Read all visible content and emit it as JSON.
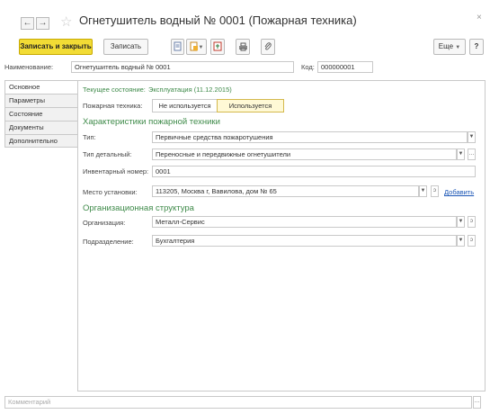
{
  "window": {
    "title": "Огнетушитель водный № 0001 (Пожарная техника)",
    "close": "×"
  },
  "nav": {
    "back": "←",
    "forward": "→",
    "favorite": "☆"
  },
  "toolbar": {
    "save_close": "Записать и закрыть",
    "save": "Записать",
    "more": "Еще",
    "help": "?"
  },
  "header_fields": {
    "name_label": "Наименование:",
    "name_value": "Огнетушитель водный № 0001",
    "code_label": "Код:",
    "code_value": "000000001"
  },
  "tabs": [
    "Основное",
    "Параметры",
    "Состояние",
    "Документы",
    "Дополнительно"
  ],
  "main": {
    "current_state_label": "Текущее состояние:",
    "current_state_value": "Эксплуатация (11.12.2015)",
    "fire_equipment_label": "Пожарная техника:",
    "toggle_off": "Не используется",
    "toggle_on": "Используется",
    "section1": "Характеристики пожарной техники",
    "type_label": "Тип:",
    "type_value": "Первичные средства пожаротушения",
    "type_detail_label": "Тип детальный:",
    "type_detail_value": "Переносные и передвижные огнетушители",
    "inventory_label": "Инвентарный номер:",
    "inventory_value": "0001",
    "location_label": "Место установки:",
    "location_value": "113205, Москва г, Вавилова, дом № 65",
    "add_link": "Добавить",
    "section2": "Организационная структура",
    "org_label": "Организация:",
    "org_value": "Металл-Сервис",
    "dept_label": "Подразделение:",
    "dept_value": "Бухгалтерия"
  },
  "comment": {
    "placeholder": "Комментарий"
  },
  "colors": {
    "accent_yellow": "#f2dc35",
    "section_green": "#3e8a49",
    "link_blue": "#1a55b5"
  }
}
